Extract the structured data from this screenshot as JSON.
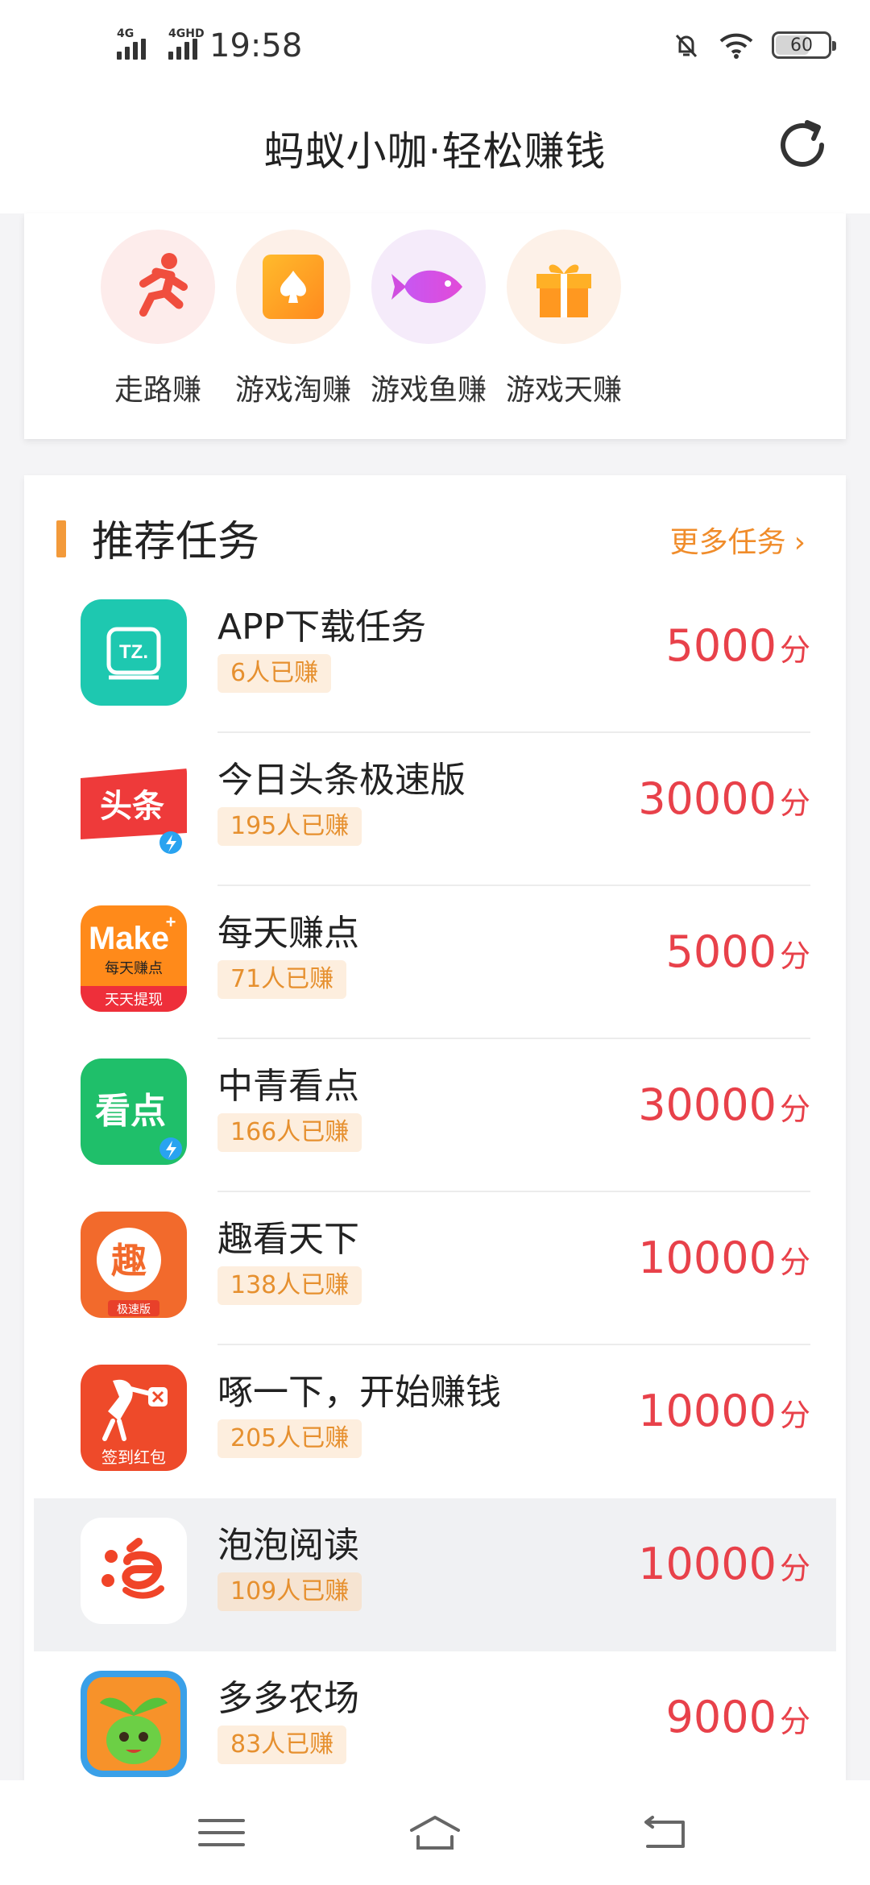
{
  "status_bar": {
    "time": "19:58",
    "signal1_label": "4G",
    "signal2_label": "4GHD",
    "battery": "60"
  },
  "header": {
    "title": "蚂蚁小咖·轻松赚钱",
    "refresh_icon": "refresh-icon"
  },
  "categories": [
    {
      "label": "走路赚",
      "icon": "running-person-icon",
      "bg": "#fdeceb"
    },
    {
      "label": "游戏淘赚",
      "icon": "spade-card-icon",
      "bg": "#fdf0e8"
    },
    {
      "label": "游戏鱼赚",
      "icon": "fish-icon",
      "bg": "#f5ebfa"
    },
    {
      "label": "游戏天赚",
      "icon": "gift-icon",
      "bg": "#fdf1e8"
    }
  ],
  "tasks_section": {
    "title": "推荐任务",
    "more_label": "更多任务"
  },
  "tasks": [
    {
      "name": "APP下载任务",
      "earned": "6人已赚",
      "points": "5000",
      "unit": "分",
      "icon": "tz-app-icon"
    },
    {
      "name": "今日头条极速版",
      "earned": "195人已赚",
      "points": "30000",
      "unit": "分",
      "icon": "toutiao-icon"
    },
    {
      "name": "每天赚点",
      "earned": "71人已赚",
      "points": "5000",
      "unit": "分",
      "icon": "make-app-icon"
    },
    {
      "name": "中青看点",
      "earned": "166人已赚",
      "points": "30000",
      "unit": "分",
      "icon": "kandian-icon"
    },
    {
      "name": "趣看天下",
      "earned": "138人已赚",
      "points": "10000",
      "unit": "分",
      "icon": "qukan-icon"
    },
    {
      "name": "啄一下，开始赚钱",
      "earned": "205人已赚",
      "points": "10000",
      "unit": "分",
      "icon": "woodpecker-icon"
    },
    {
      "name": "泡泡阅读",
      "earned": "109人已赚",
      "points": "10000",
      "unit": "分",
      "icon": "paopao-icon"
    },
    {
      "name": "多多农场",
      "earned": "83人已赚",
      "points": "9000",
      "unit": "分",
      "icon": "farm-sprout-icon"
    }
  ],
  "icon_text": {
    "tz": "TZ.",
    "toutiao": "头条",
    "make": "Make",
    "make_sub": "每天赚点",
    "make_band": "天天提现",
    "kandian": "看点",
    "qu": "趣",
    "qu_band": "极速版",
    "woodpecker_band": "签到红包"
  },
  "colors": {
    "accent_orange": "#f08c2a",
    "points_red": "#e8414a"
  }
}
